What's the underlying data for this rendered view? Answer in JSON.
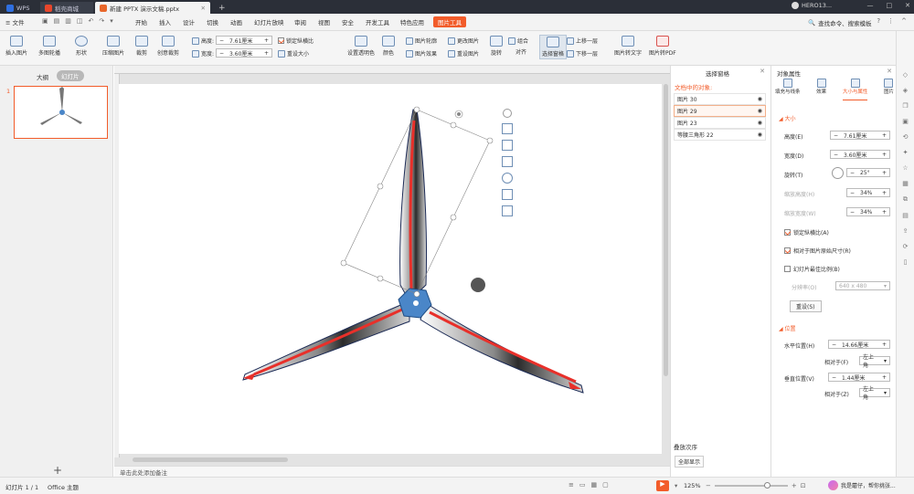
{
  "titlebar": {
    "tabs": [
      {
        "label": "WPS",
        "color": "#2f6fe0"
      },
      {
        "label": "稻壳商城",
        "color": "#e8462b"
      },
      {
        "label": "新建 PPTX 演示文稿.pptx",
        "color": "#e8672b"
      }
    ],
    "add": "+",
    "window": [
      "—",
      "□",
      "✕"
    ]
  },
  "menubar": {
    "file": "≡ 文件",
    "items": [
      "开始",
      "插入",
      "设计",
      "切换",
      "动画",
      "幻灯片放映",
      "审阅",
      "视图",
      "安全",
      "开发工具",
      "特色应用"
    ],
    "active": "图片工具",
    "search": "查找命令、搜索模板",
    "user": "HERO13..."
  },
  "ribbon": {
    "big": [
      "插入图片",
      "多图轮播",
      "形状",
      "压缩图片",
      "裁剪",
      "创意裁剪",
      "设置透明色",
      "颜色",
      "旋转",
      "对齐",
      "选择窗格",
      "图片转文字",
      "图片转PDF"
    ],
    "height_label": "高度:",
    "height_value": "7.61厘米",
    "width_label": "宽度:",
    "width_value": "3.60厘米",
    "lock": "锁定纵横比",
    "reset_size": "重设大小",
    "outline": "图片轮廓",
    "effect": "图片效果",
    "change": "更改图片",
    "reset": "重设图片",
    "combine": "组合",
    "up": "上移一层",
    "down": "下移一层"
  },
  "leftpane": {
    "outline_tab": "大纲",
    "slides_tab": "幻灯片",
    "slide_number": "1",
    "add": "+"
  },
  "selpane": {
    "title": "选择窗格",
    "header": "文档中的对象:",
    "items": [
      "图片 30",
      "图片 29",
      "图片 23",
      "等腰三角形 22"
    ],
    "order": "叠放次序",
    "show_all": "全部显示"
  },
  "proppane": {
    "title": "对象属性",
    "tabs": [
      "填充与线条",
      "效果",
      "大小与属性",
      "图片"
    ],
    "section_size": "大小",
    "height_label": "高度(E)",
    "height_value": "7.61厘米",
    "width_label": "宽度(D)",
    "width_value": "3.60厘米",
    "rotate_label": "旋转(T)",
    "rotate_value": "25°",
    "scale_h_label": "缩放高度(H)",
    "scale_h_value": "34%",
    "scale_w_label": "缩放宽度(W)",
    "scale_w_value": "34%",
    "lock_ratio": "锁定纵横比(A)",
    "relative": "相对于图片原始尺寸(R)",
    "best_scale": "幻灯片最佳比例(B)",
    "resolution_label": "分辨率(O)",
    "resolution_value": "640 x 480",
    "reset_btn": "重设(S)",
    "section_pos": "位置",
    "hpos_label": "水平位置(H)",
    "hpos_value": "14.66厘米",
    "hrel_label": "相对于(F)",
    "hrel_value": "左上角",
    "vpos_label": "垂直位置(V)",
    "vpos_value": "1.44厘米",
    "vrel_label": "相对于(Z)",
    "vrel_value": "左上角"
  },
  "notes": {
    "placeholder": "单击此处添加备注"
  },
  "statusbar": {
    "slide_info": "幻灯片 1 / 1",
    "theme": "Office 主题",
    "zoom": "125%",
    "assistant": "我是蘑仔，帮你挑张..."
  },
  "colors": {
    "accent": "#f25c2a",
    "blade_red": "#e8302a",
    "hub_blue": "#4a86c8"
  }
}
